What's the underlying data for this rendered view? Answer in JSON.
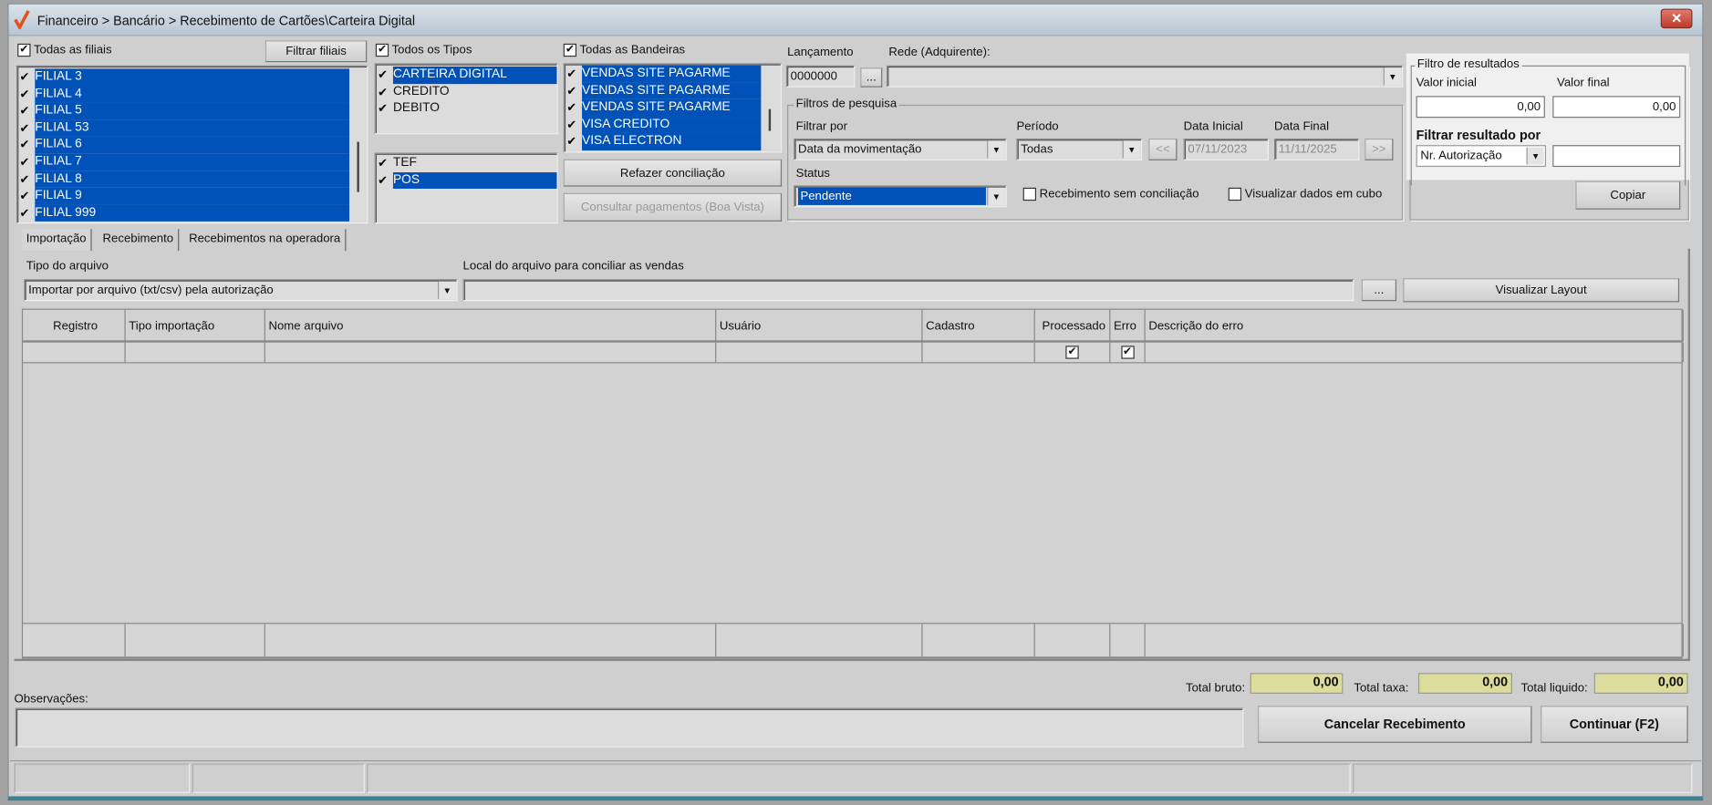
{
  "window": {
    "title": "Financeiro > Bancário > Recebimento de Cartões\\Carteira Digital",
    "close_icon": "close-icon"
  },
  "filiais": {
    "all_label": "Todas as filiais",
    "filter_button": "Filtrar filiais",
    "items": [
      "FILIAL 3",
      "FILIAL 4",
      "FILIAL 5",
      "FILIAL 53",
      "FILIAL 6",
      "FILIAL 7",
      "FILIAL 8",
      "FILIAL 9",
      "FILIAL 999"
    ]
  },
  "tipos": {
    "all_label": "Todos os Tipos",
    "items": [
      {
        "label": "CARTEIRA DIGITAL",
        "selected": true
      },
      {
        "label": "CREDITO",
        "selected": false
      },
      {
        "label": "DEBITO",
        "selected": false
      }
    ],
    "modes": [
      {
        "label": "TEF",
        "selected": false
      },
      {
        "label": "POS",
        "selected": true
      }
    ]
  },
  "bandeiras": {
    "all_label": "Todas as Bandeiras",
    "items": [
      "VENDAS SITE PAGARME",
      "VENDAS SITE PAGARME",
      "VENDAS SITE PAGARME",
      "VISA CREDITO",
      "VISA ELECTRON"
    ]
  },
  "actions": {
    "refazer": "Refazer conciliação",
    "consultar": "Consultar pagamentos (Boa Vista)"
  },
  "lancamento": {
    "label": "Lançamento",
    "value": "0000000",
    "browse": "...",
    "rede_label": "Rede (Adquirente):",
    "rede_value": ""
  },
  "filtros": {
    "legend": "Filtros de pesquisa",
    "filtrar_por_label": "Filtrar por",
    "filtrar_por_value": "Data da movimentação",
    "periodo_label": "Período",
    "periodo_value": "Todas",
    "prev": "<<",
    "next": ">>",
    "data_inicial_label": "Data Inicial",
    "data_inicial": "07/11/2023",
    "data_final_label": "Data Final",
    "data_final": "11/11/2025",
    "status_label": "Status",
    "status_value": "Pendente",
    "sem_conciliacao": "Recebimento sem conciliação",
    "cubo": "Visualizar dados em cubo"
  },
  "resultados": {
    "legend": "Filtro de resultados",
    "valor_inicial_label": "Valor inicial",
    "valor_inicial": "0,00",
    "valor_final_label": "Valor final",
    "valor_final": "0,00",
    "filtrar_por_label": "Filtrar resultado por",
    "filtrar_por_value": "Nr. Autorização",
    "filtrar_texto": "",
    "copiar": "Copiar"
  },
  "tabs": [
    "Importação",
    "Recebimento",
    "Recebimentos na operadora"
  ],
  "import": {
    "tipo_label": "Tipo do arquivo",
    "tipo_value": "Importar por arquivo (txt/csv) pela autorização",
    "local_label": "Local do arquivo para conciliar as vendas",
    "local_value": "",
    "browse": "...",
    "layout_button": "Visualizar Layout"
  },
  "grid": {
    "columns": [
      "Registro",
      "Tipo importação",
      "Nome arquivo",
      "Usuário",
      "Cadastro",
      "Processado",
      "Erro",
      "Descrição do erro"
    ]
  },
  "totals": {
    "bruto_label": "Total bruto:",
    "bruto": "0,00",
    "taxa_label": "Total taxa:",
    "taxa": "0,00",
    "liquido_label": "Total liquido:",
    "liquido": "0,00"
  },
  "obs": {
    "label": "Observações:",
    "value": ""
  },
  "buttons": {
    "cancelar": "Cancelar Recebimento",
    "continuar": "Continuar (F2)"
  }
}
